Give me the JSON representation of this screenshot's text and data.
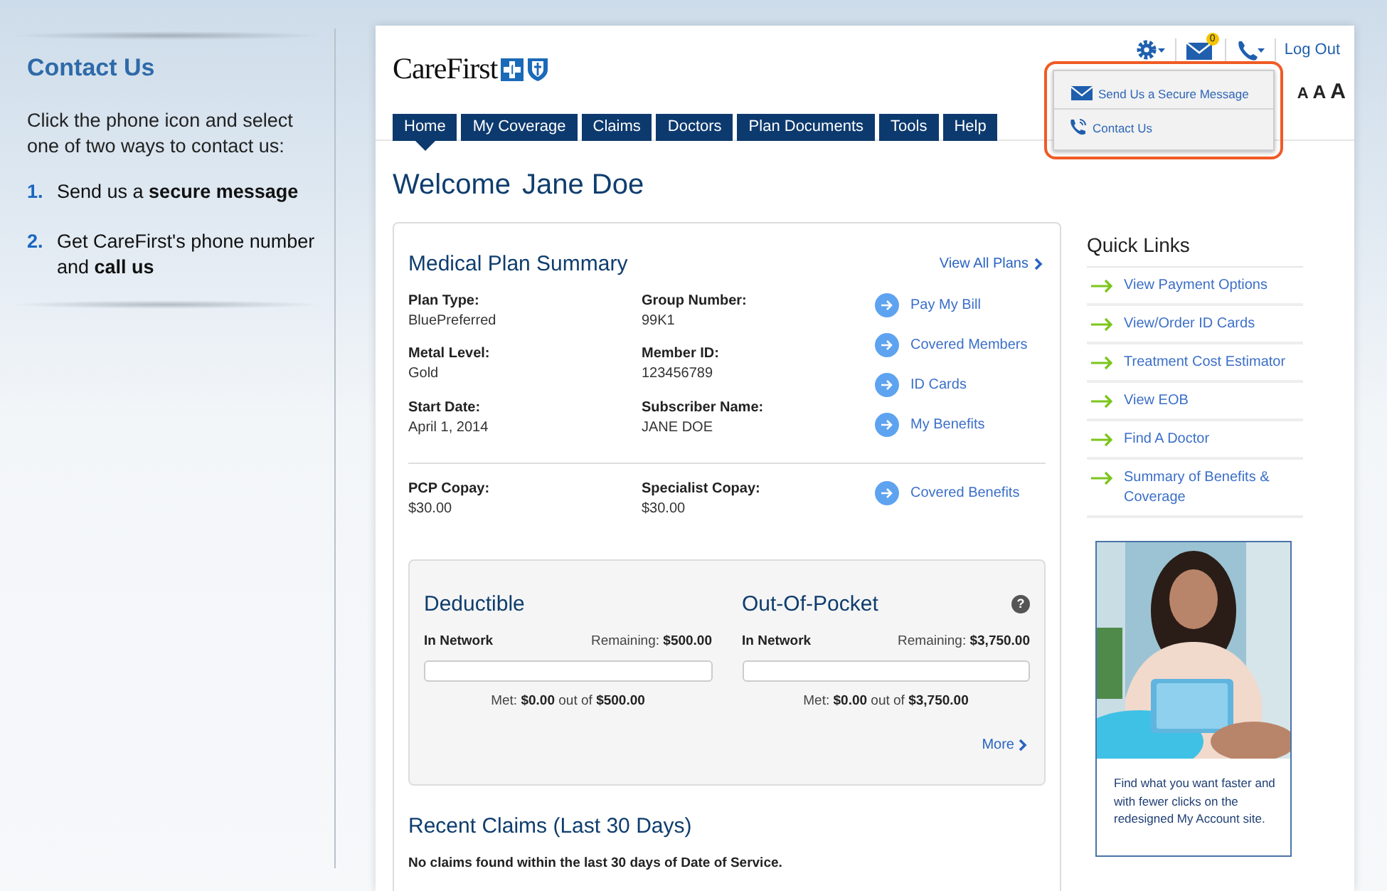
{
  "help_panel": {
    "title": "Contact Us",
    "intro": "Click the phone icon and select one of two ways to contact us:",
    "steps": [
      {
        "number": "1.",
        "text": "Send us a **secure message**"
      },
      {
        "number": "2.",
        "text": "Get CareFirst's phone number and **call us**"
      }
    ]
  },
  "header": {
    "logo": "CareFirst",
    "mail_badge": "0",
    "logout": "Log Out",
    "font_sizes": [
      "A",
      "A",
      "A"
    ],
    "dropdown": {
      "highlighted": true,
      "items": [
        {
          "kind": "mail",
          "label": "Send Us a Secure Message"
        },
        {
          "kind": "phone",
          "label": "Contact Us"
        }
      ]
    }
  },
  "tabs": [
    {
      "label": "Home",
      "selected": true
    },
    {
      "label": "My Coverage",
      "selected": false
    },
    {
      "label": "Claims",
      "selected": false
    },
    {
      "label": "Doctors",
      "selected": false
    },
    {
      "label": "Plan Documents",
      "selected": false
    },
    {
      "label": "Tools",
      "selected": false
    },
    {
      "label": "Help",
      "selected": false
    }
  ],
  "welcome": {
    "greeting": "Welcome",
    "name": "Jane Doe"
  },
  "plan_summary": {
    "title": "Medical Plan Summary",
    "view_all": "View All Plans",
    "fields": [
      {
        "label": "Plan Type:",
        "value": "BluePreferred"
      },
      {
        "label": "Group Number:",
        "value": "99K1"
      },
      {
        "label": "Metal Level:",
        "value": "Gold"
      },
      {
        "label": "Member ID:",
        "value": "123456789"
      },
      {
        "label": "Start Date:",
        "value": "April 1, 2014"
      },
      {
        "label": "Subscriber Name:",
        "value": "JANE DOE"
      }
    ],
    "links": [
      "Pay My Bill",
      "Covered Members",
      "ID Cards",
      "My Benefits"
    ],
    "copays": [
      {
        "label": "PCP Copay:",
        "value": "$30.00"
      },
      {
        "label": "Specialist Copay:",
        "value": "$30.00"
      }
    ],
    "copay_link": "Covered Benefits"
  },
  "accumulators": [
    {
      "title": "Deductible",
      "network": "In Network",
      "remaining_label": "Remaining:",
      "remaining": "$500.00",
      "level": 0,
      "met_label": "Met:",
      "met": "$0.00",
      "out_of": "out of",
      "total": "$500.00"
    },
    {
      "title": "Out-Of-Pocket",
      "network": "In Network",
      "remaining_label": "Remaining:",
      "remaining": "$3,750.00",
      "level": 0,
      "met_label": "Met:",
      "met": "$0.00",
      "out_of": "out of",
      "total": "$3,750.00",
      "help_icon": "?"
    }
  ],
  "more_link": "More",
  "recent_claims": {
    "title": "Recent Claims (Last 30 Days)",
    "message": "No claims found within the last 30 days of Date of Service."
  },
  "quick_links": {
    "title": "Quick Links",
    "items": [
      "View Payment Options",
      "View/Order ID Cards",
      "Treatment Cost Estimator",
      "View EOB",
      "Find A Doctor",
      "Summary of Benefits & Coverage"
    ]
  },
  "promo": {
    "text": "Find what you want faster and with fewer clicks on the redesigned My Account site."
  }
}
